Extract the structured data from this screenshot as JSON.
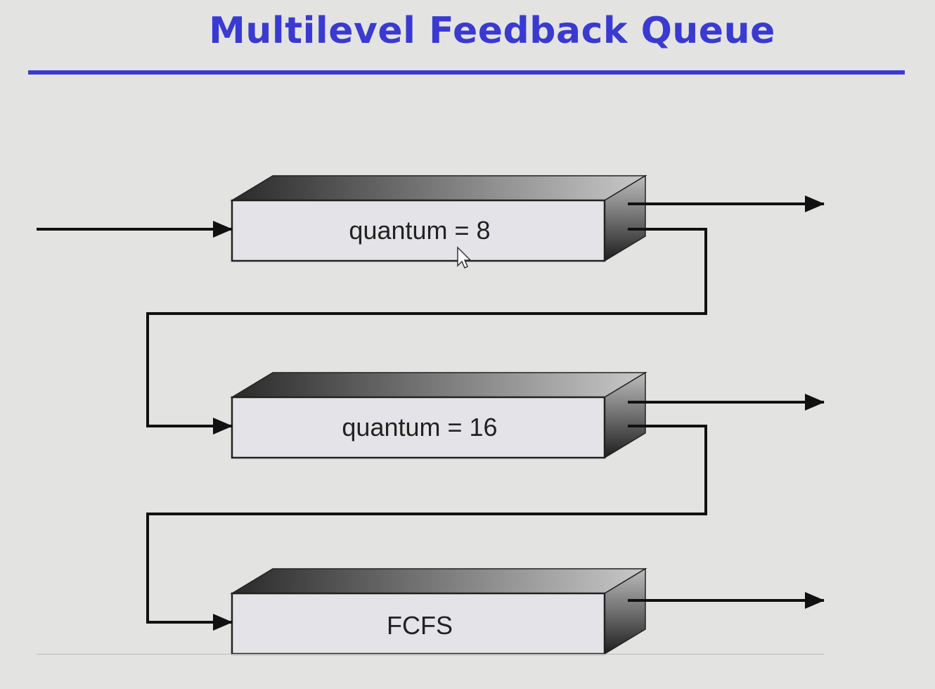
{
  "title": "Multilevel Feedback Queue",
  "queues": [
    {
      "label": "quantum = 8"
    },
    {
      "label": "quantum = 16"
    },
    {
      "label": "FCFS"
    }
  ],
  "colors": {
    "title": "#3a3ad0",
    "background": "#e3e3e2",
    "queue_face": "#e4e4e8",
    "line": "#111111"
  }
}
